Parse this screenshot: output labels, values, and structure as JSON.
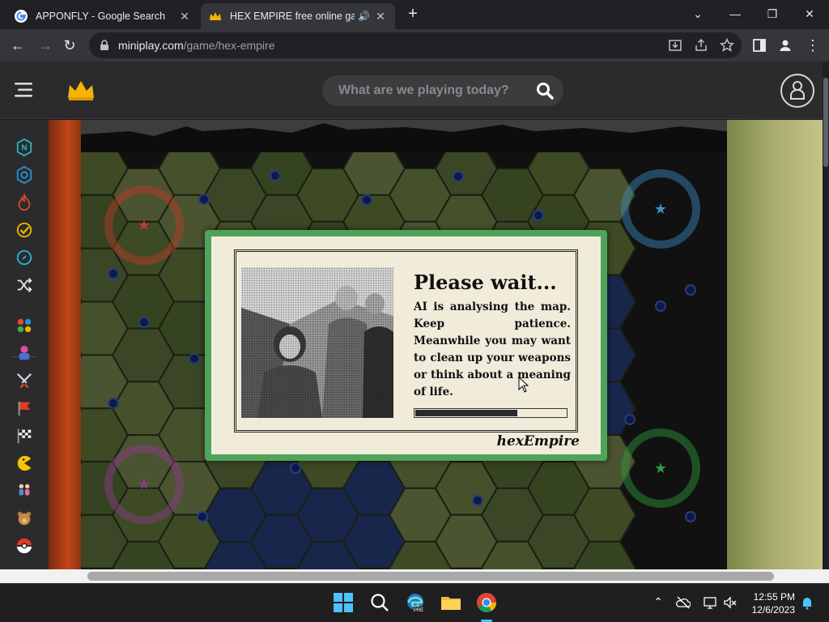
{
  "browser": {
    "tabs": [
      {
        "title": "APPONFLY - Google Search",
        "active": false
      },
      {
        "title": "HEX EMPIRE free online game",
        "active": true
      }
    ],
    "new_tab_label": "+",
    "url_host": "miniplay.com",
    "url_path": "/game/hex-empire"
  },
  "site": {
    "search_placeholder": "What are we playing today?"
  },
  "sidebar": {
    "icons": [
      "news-icon",
      "hex-icon",
      "fire-icon",
      "check-icon",
      "compass-icon",
      "shuffle-icon",
      "dots-icon",
      "brawler-icon",
      "swords-icon",
      "flag-icon",
      "racing-flag-icon",
      "pacman-icon",
      "kids-icon",
      "teddy-icon",
      "pokeball-icon"
    ]
  },
  "dialog": {
    "title": "Please wait...",
    "message": "AI is analysing the map. Keep patience. Meanwhile you may want to clean up your weapons or think about a meaning of life.",
    "progress": 0.68,
    "brand": "hexEmpire"
  },
  "taskbar": {
    "time": "12:55 PM",
    "date": "12/6/2023"
  },
  "colors": {
    "dialog_border": "#4fa35a",
    "dialog_paper": "#f1ecda",
    "red_faction": "#c0392b",
    "blue_faction": "#3a8fc4",
    "purple_faction": "#8e3a8e",
    "green_faction": "#2e9e3e"
  }
}
